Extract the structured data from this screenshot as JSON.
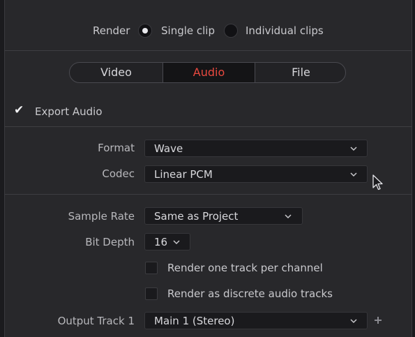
{
  "render": {
    "label": "Render",
    "options": [
      {
        "label": "Single clip",
        "selected": true
      },
      {
        "label": "Individual clips",
        "selected": false
      }
    ]
  },
  "tabs": [
    {
      "label": "Video",
      "active": false
    },
    {
      "label": "Audio",
      "active": true
    },
    {
      "label": "File",
      "active": false
    }
  ],
  "export_audio": {
    "label": "Export Audio",
    "checked": true
  },
  "fields": {
    "format": {
      "label": "Format",
      "value": "Wave"
    },
    "codec": {
      "label": "Codec",
      "value": "Linear PCM"
    },
    "sample_rate": {
      "label": "Sample Rate",
      "value": "Same as Project"
    },
    "bit_depth": {
      "label": "Bit Depth",
      "value": "16"
    },
    "output_track": {
      "label": "Output Track 1",
      "value": "Main 1 (Stereo)"
    }
  },
  "options": {
    "per_channel": {
      "label": "Render one track per channel",
      "checked": false
    },
    "discrete": {
      "label": "Render as discrete audio tracks",
      "checked": false
    }
  },
  "colors": {
    "accent": "#e8493f",
    "panel": "#28282b",
    "field": "#1a1a1d"
  },
  "icons": {
    "chevron": "chevron-down-icon",
    "add": "plus-icon",
    "cursor": "mouse-pointer-icon"
  }
}
